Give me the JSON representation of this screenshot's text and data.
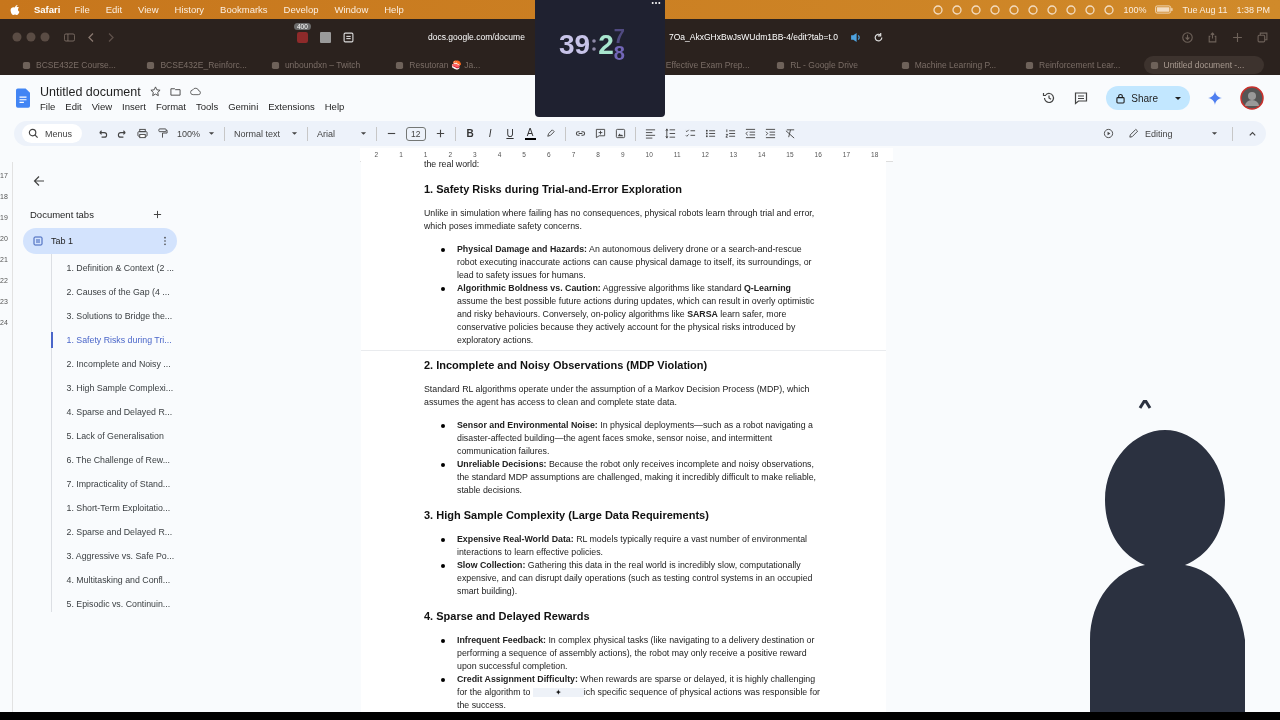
{
  "menu_bar": {
    "app": "Safari",
    "items": [
      "File",
      "Edit",
      "View",
      "History",
      "Bookmarks",
      "Develop",
      "Window",
      "Help"
    ],
    "battery": "100%",
    "date": "Tue Aug 11",
    "time": "1:38 PM"
  },
  "browser": {
    "badge": "400",
    "url_start": "docs.google.com/docume",
    "url_end": "7Oa_AkxGHxBwJsWUdm1BB-4/edit?tab=t.0",
    "tabs": [
      {
        "title": "BCSE432E Course...",
        "selected": false
      },
      {
        "title": "BCSE432E_Reinforc...",
        "selected": false
      },
      {
        "title": "unboundxn – Twitch",
        "selected": false
      },
      {
        "title": "Resutoran 🍣 Ja...",
        "selected": false
      },
      {
        "title": "Effective Exam Prep...",
        "selected": false
      },
      {
        "title": "RL - Google Drive",
        "selected": false
      },
      {
        "title": "Machine Learning P...",
        "selected": false
      },
      {
        "title": "Reinforcement Lear...",
        "selected": false
      },
      {
        "title": "Untitled document -...",
        "selected": true
      }
    ]
  },
  "timer": {
    "minutes": "39",
    "tens": "2",
    "previous_digit": "7",
    "digit": "8"
  },
  "docs": {
    "title": "Untitled document",
    "menus": [
      "File",
      "Edit",
      "View",
      "Insert",
      "Format",
      "Tools",
      "Gemini",
      "Extensions",
      "Help"
    ],
    "share": "Share"
  },
  "toolbar": {
    "search": "Menus",
    "zoom": "100%",
    "style": "Normal text",
    "font": "Arial",
    "size": "12",
    "format": [
      "B",
      "I",
      "U",
      "A"
    ],
    "mode": "Editing"
  },
  "ruler": {
    "labels": [
      "2",
      "1",
      "1",
      "2",
      "3",
      "4",
      "5",
      "6",
      "7",
      "8",
      "9",
      "10",
      "11",
      "12",
      "13",
      "14",
      "15",
      "16",
      "17",
      "18"
    ],
    "side_labels": [
      "17",
      "18",
      "19",
      "20",
      "21",
      "22",
      "23",
      "24"
    ]
  },
  "sidebar": {
    "heading": "Document tabs",
    "tab": {
      "label": "Tab 1",
      "selected": true
    },
    "outline": [
      {
        "label": "1. Definition & Context (2 ...",
        "selected": false
      },
      {
        "label": "2. Causes of the Gap (4 ...",
        "selected": false
      },
      {
        "label": "3. Solutions to Bridge the...",
        "selected": false
      },
      {
        "label": "1. Safety Risks during Tri...",
        "selected": true
      },
      {
        "label": "2. Incomplete and Noisy ...",
        "selected": false
      },
      {
        "label": "3. High Sample Complexi...",
        "selected": false
      },
      {
        "label": "4. Sparse and Delayed R...",
        "selected": false
      },
      {
        "label": "5. Lack of Generalisation",
        "selected": false
      },
      {
        "label": "6. The Challenge of Rew...",
        "selected": false
      },
      {
        "label": "7. Impracticality of Stand...",
        "selected": false
      },
      {
        "label": "1. Short-Term Exploitatio...",
        "selected": false
      },
      {
        "label": "2. Sparse and Delayed R...",
        "selected": false
      },
      {
        "label": "3. Aggressive vs. Safe Po...",
        "selected": false
      },
      {
        "label": "4. Multitasking and Confl...",
        "selected": false
      },
      {
        "label": "5. Episodic vs. Continuin...",
        "selected": false
      }
    ]
  },
  "pages": [
    {
      "blocks": [
        {
          "kind": "text",
          "text": "the real world:"
        },
        {
          "kind": "heading",
          "text": "1. Safety Risks during Trial-and-Error Exploration"
        },
        {
          "kind": "text",
          "text": "Unlike in simulation where failing has no consequences, physical robots learn through trial and error, which poses immediate safety concerns."
        },
        {
          "kind": "bullet",
          "text": "**Physical Damage and Hazards:** An autonomous delivery drone or a search-and-rescue robot executing inaccurate actions can cause physical damage to itself, its surroundings, or lead to safety issues for humans."
        },
        {
          "kind": "bullet",
          "text": "**Algorithmic Boldness vs. Caution:** Aggressive algorithms like standard **Q-Learning** assume the best possible future actions during updates, which can result in overly optimistic and risky behaviours. Conversely, on-policy algorithms like **SARSA** learn safer, more conservative policies because they actively account for the physical risks introduced by exploratory actions."
        }
      ]
    },
    {
      "blocks": [
        {
          "kind": "heading",
          "text": "2. Incomplete and Noisy Observations (MDP Violation)"
        },
        {
          "kind": "text",
          "text": "Standard RL algorithms operate under the assumption of a Markov Decision Process (MDP), which assumes the agent has access to clean and complete state data."
        },
        {
          "kind": "bullet",
          "text": "**Sensor and Environmental Noise:** In physical deployments—such as a robot navigating a disaster-affected building—the agent faces smoke, sensor noise, and intermittent communication failures."
        },
        {
          "kind": "bullet",
          "text": "**Unreliable Decisions:** Because the robot only receives incomplete and noisy observations, the standard MDP assumptions are challenged, making it incredibly difficult to make reliable, stable decisions."
        },
        {
          "kind": "heading",
          "text": "3. High Sample Complexity (Large Data Requirements)"
        },
        {
          "kind": "bullet",
          "text": "**Expensive Real-World Data:** RL models typically require a vast number of environmental interactions to learn effective policies."
        },
        {
          "kind": "bullet",
          "text": "**Slow Collection:** Gathering this data in the real world is incredibly slow, computationally expensive, and can disrupt daily operations (such as testing control systems in an occupied smart building)."
        },
        {
          "kind": "heading",
          "text": "4. Sparse and Delayed Rewards"
        },
        {
          "kind": "bullet",
          "text": "**Infrequent Feedback:** In complex physical tasks (like navigating to a delivery destination or performing a sequence of assembly actions), the robot may only receive a positive reward upon successful completion."
        },
        {
          "kind": "bullet",
          "text": "**Credit Assignment Difficulty:** When rewards are sparse or delayed, it is highly challenging for the algorithm to",
          "chip": "✦",
          "text_after": "ich specific sequence of physical actions was responsible for the success."
        }
      ]
    }
  ]
}
